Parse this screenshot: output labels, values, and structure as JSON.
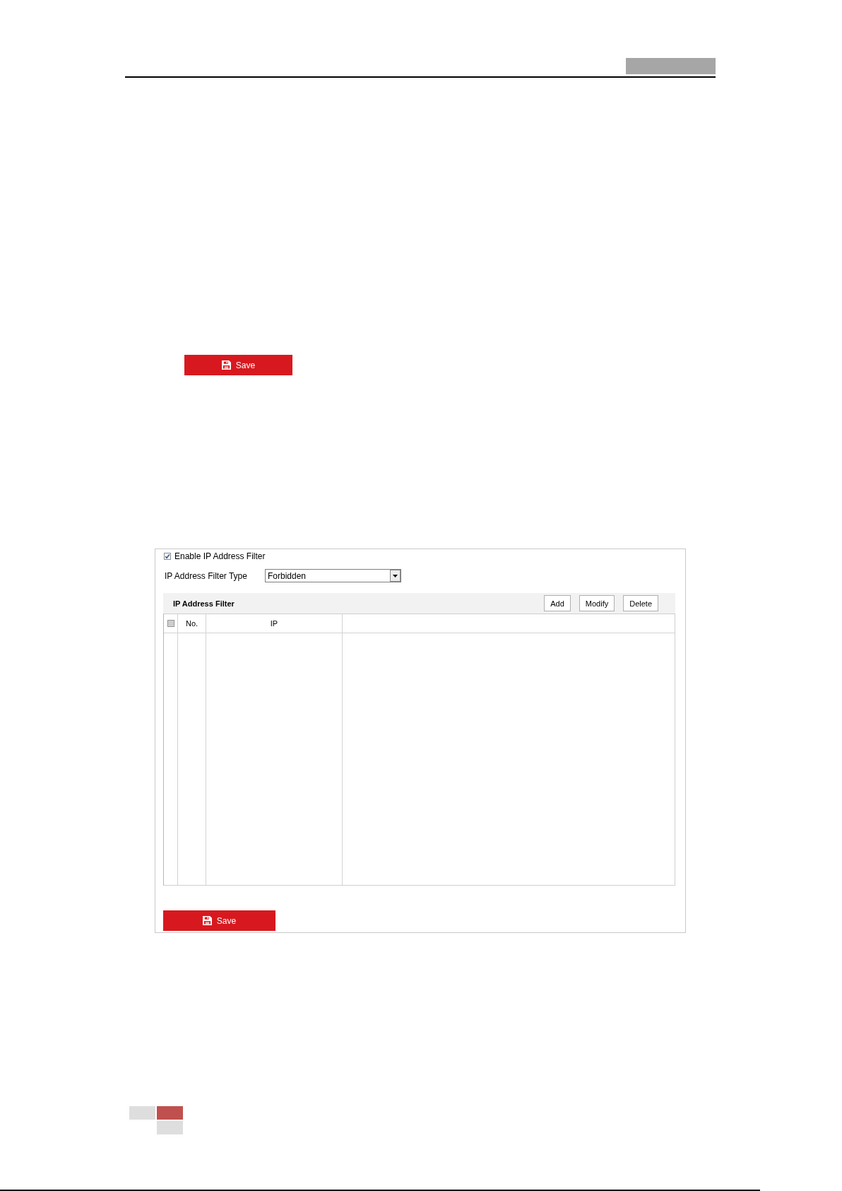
{
  "top_section": {
    "save_button": {
      "label": "Save"
    }
  },
  "panel": {
    "enable_filter": {
      "label": "Enable IP Address Filter",
      "checked": true
    },
    "filter_type": {
      "label": "IP Address Filter Type",
      "value": "Forbidden"
    },
    "filter_list": {
      "title": "IP Address Filter",
      "buttons": [
        "Add",
        "Modify",
        "Delete"
      ],
      "table": {
        "select_all": {
          "checked": false
        },
        "columns": [
          "No.",
          "IP"
        ]
      }
    },
    "save_button": {
      "label": "Save"
    }
  }
}
